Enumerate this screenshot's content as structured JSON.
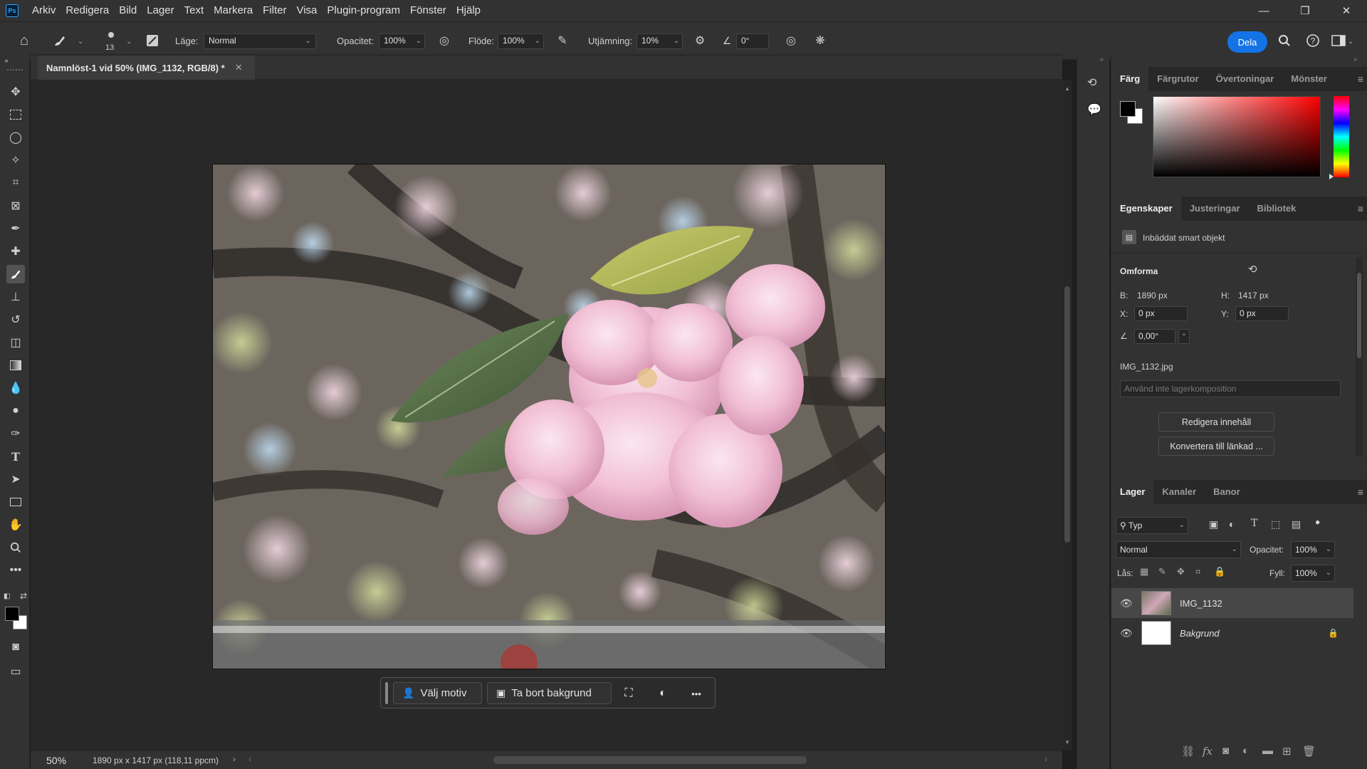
{
  "app": {
    "logo": "Ps"
  },
  "menu": [
    "Arkiv",
    "Redigera",
    "Bild",
    "Lager",
    "Text",
    "Markera",
    "Filter",
    "Visa",
    "Plugin-program",
    "Fönster",
    "Hjälp"
  ],
  "window_controls": {
    "minimize": "—",
    "restore": "❐",
    "close": "✕"
  },
  "options": {
    "brush_size": "13",
    "mode_label": "Läge:",
    "mode_value": "Normal",
    "opacity_label": "Opacitet:",
    "opacity_value": "100%",
    "flow_label": "Flöde:",
    "flow_value": "100%",
    "smoothing_label": "Utjämning:",
    "smoothing_value": "10%",
    "angle_value": "0°",
    "share_label": "Dela"
  },
  "document": {
    "tab_title": "Namnlöst-1 vid 50% (IMG_1132, RGB/8) *",
    "zoom": "50%",
    "dimensions": "1890 px x 1417 px (118,11 ppcm)"
  },
  "taskbar": {
    "select_subject": "Välj motiv",
    "remove_background": "Ta bort bakgrund",
    "more": "•••"
  },
  "color_panel": {
    "tabs": [
      "Färg",
      "Färgrutor",
      "Övertoningar",
      "Mönster"
    ],
    "hue_color": "#ff0000"
  },
  "properties_panel": {
    "tabs": [
      "Egenskaper",
      "Justeringar",
      "Bibliotek"
    ],
    "object_type": "Inbäddat smart objekt",
    "section": "Omforma",
    "width_label": "B:",
    "width_value": "1890 px",
    "height_label": "H:",
    "height_value": "1417 px",
    "x_label": "X:",
    "x_value": "0 px",
    "y_label": "Y:",
    "y_value": "0 px",
    "angle_value": "0,00°",
    "filename": "IMG_1132.jpg",
    "comp_placeholder": "Använd inte lagerkomposition",
    "edit_contents": "Redigera innehåll",
    "convert_linked": "Konvertera till länkad ..."
  },
  "layers_panel": {
    "tabs": [
      "Lager",
      "Kanaler",
      "Banor"
    ],
    "filter_kind": "Typ",
    "blend_mode": "Normal",
    "opacity_label": "Opacitet:",
    "opacity_value": "100%",
    "lock_label": "Lås:",
    "fill_label": "Fyll:",
    "fill_value": "100%",
    "layers": [
      {
        "name": "IMG_1132",
        "selected": true
      },
      {
        "name": "Bakgrund",
        "selected": false
      }
    ]
  }
}
